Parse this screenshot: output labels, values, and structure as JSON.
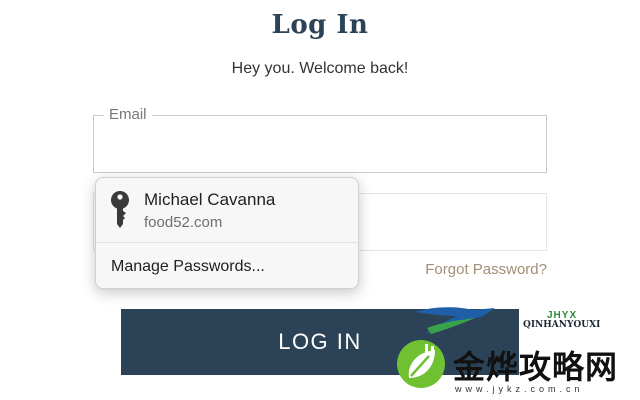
{
  "page": {
    "title": "Log In",
    "subtitle": "Hey you. Welcome back!"
  },
  "form": {
    "email_label": "Email",
    "email_value": "",
    "password_value": "",
    "forgot_link": "Forgot Password?",
    "submit_label": "LOG IN"
  },
  "autofill_popup": {
    "credential": {
      "name": "Michael Cavanna",
      "site": "food52.com",
      "icon": "key-icon"
    },
    "manage_label": "Manage Passwords..."
  },
  "watermark": {
    "brand_abbrev": "JHYX",
    "brand_pinyin": "QINHANYOUXI",
    "brand_cn": "金烨攻略网",
    "url": "www.jykz.com.cn"
  },
  "colors": {
    "primary": "#2c4357",
    "link": "#a08e76",
    "watermark_green": "#6fc132",
    "watermark_blue": "#1e5fa8"
  }
}
